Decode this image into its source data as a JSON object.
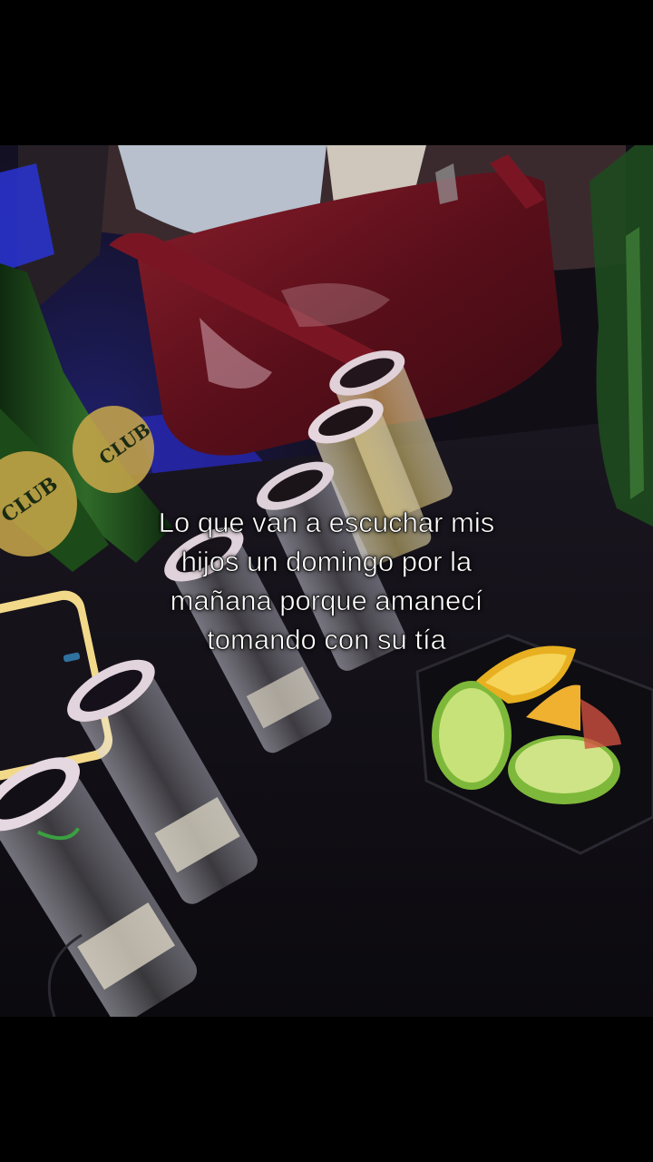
{
  "caption": {
    "lines": [
      "Lo que van a escuchar mis",
      "hijos un domingo por la",
      "mañana porque amanecí",
      "tomando con su tía"
    ]
  },
  "scene": {
    "bottle_label": "CLUB",
    "colors": {
      "purse": "#6e1420",
      "neon": "#2430c8",
      "bottle": "#1f4a1c",
      "lime": "#9ccd4a",
      "lemon": "#f2c12c",
      "table": "#15121a"
    }
  }
}
